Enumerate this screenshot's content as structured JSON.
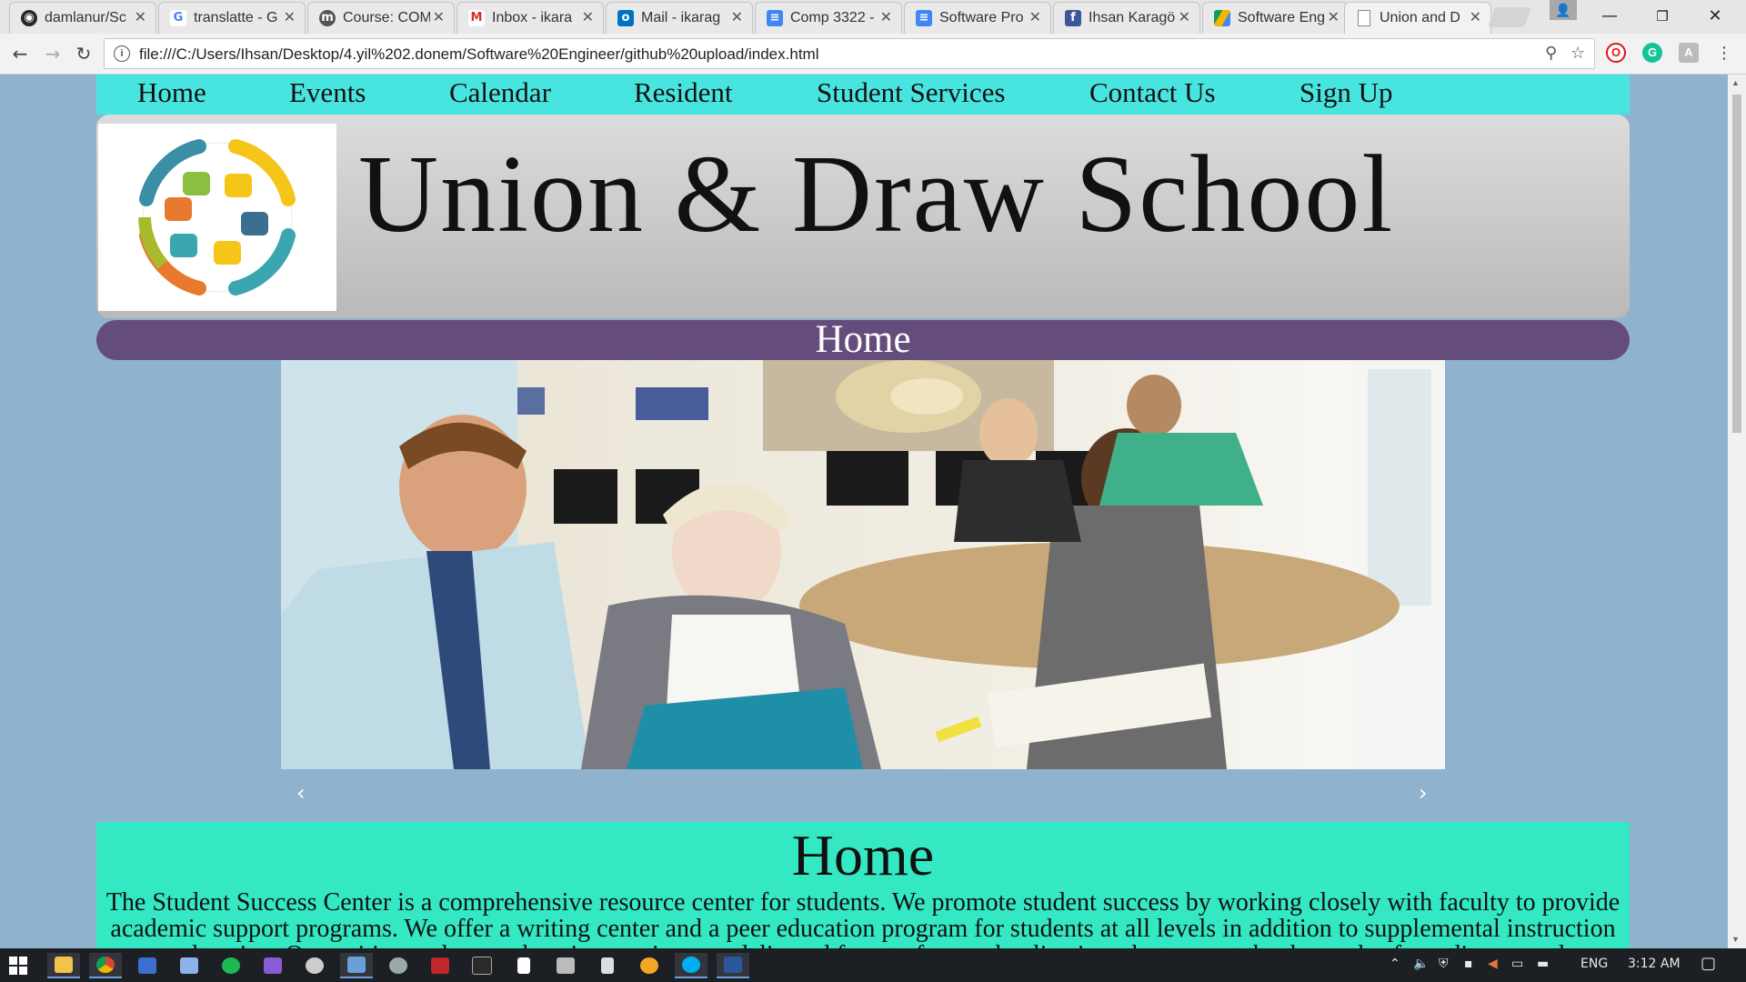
{
  "browser": {
    "tabs": [
      {
        "icon": "github-icon",
        "label": "damlanur/Sc",
        "color": "#24292e"
      },
      {
        "icon": "google-icon",
        "label": "translatte - G",
        "color": "#4285f4"
      },
      {
        "icon": "moodle-icon",
        "label": "Course: COM",
        "color": "#555555"
      },
      {
        "icon": "gmail-icon",
        "label": "Inbox - ikara",
        "color": "#d93025"
      },
      {
        "icon": "outlook-icon",
        "label": "Mail - ikarag",
        "color": "#0072c6"
      },
      {
        "icon": "docs-icon",
        "label": "Comp 3322 -",
        "color": "#4285f4"
      },
      {
        "icon": "docs-icon",
        "label": "Software Pro",
        "color": "#4285f4"
      },
      {
        "icon": "facebook-icon",
        "label": "Ihsan Karagö",
        "color": "#3b5998"
      },
      {
        "icon": "drive-icon",
        "label": "Software Eng",
        "color": "#f4b400"
      },
      {
        "icon": "page-icon",
        "label": "Union and D",
        "color": "#777777",
        "active": true
      }
    ],
    "url": "file:///C:/Users/Ihsan/Desktop/4.yil%202.donem/Software%20Engineer/github%20upload/index.html"
  },
  "nav": {
    "items": [
      "Home",
      "Events",
      "Calendar",
      "Resident",
      "Student Services",
      "Contact Us",
      "Sign Up"
    ]
  },
  "banner": {
    "school_name": "Union & Draw School"
  },
  "section": {
    "title": "Home"
  },
  "carousel": {
    "prev": "‹",
    "next": "›"
  },
  "content": {
    "heading": "Home",
    "text": "The Student Success Center is a comprehensive resource center for students. We promote student success by working closely with faculty to provide academic support programs. We offer a writing center and a peer education program for students at all levels in addition to supplemental instruction and testing. Our writing and peer education services are delivered face-to-face and online in order to meet the demands of our diverse and widespread"
  },
  "taskbar": {
    "language": "ENG",
    "time": "3:12 AM"
  },
  "colors": {
    "page_bg": "#8fb3cf",
    "nav_bg": "#48e5e0",
    "section_bar": "#644c7c",
    "content_bg": "#34e8c4"
  }
}
